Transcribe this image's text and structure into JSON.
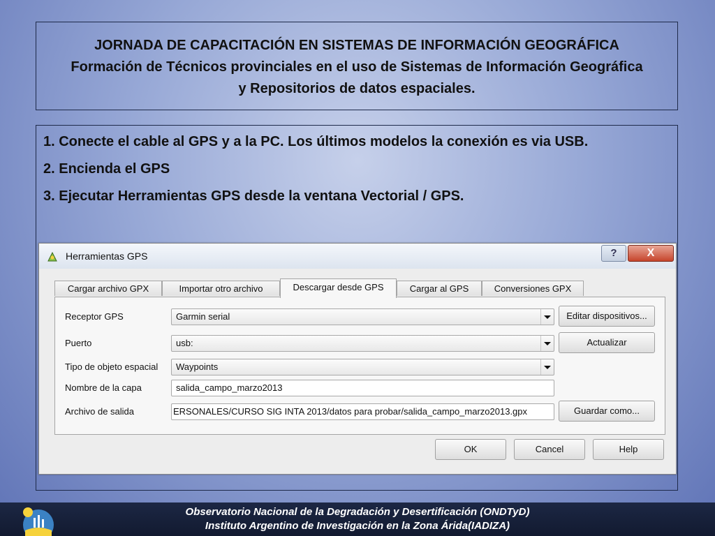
{
  "header": {
    "title_line1": "JORNADA DE CAPACITACIÓN EN SISTEMAS DE INFORMACIÓN GEOGRÁFICA",
    "title_line2": "Formación de Técnicos provinciales en el uso de Sistemas de Información Geográfica",
    "title_line3": "y  Repositorios de datos espaciales."
  },
  "steps": [
    "1. Conecte el cable al GPS y a la PC. Los últimos modelos la conexión es via USB.",
    "2. Encienda el GPS",
    "3. Ejecutar Herramientas GPS desde la ventana Vectorial / GPS."
  ],
  "dialog": {
    "title": "Herramientas GPS",
    "help_label": "?",
    "close_label": "X",
    "tabs": [
      {
        "label": "Cargar archivo GPX"
      },
      {
        "label": "Importar otro archivo"
      },
      {
        "label": "Descargar desde GPS",
        "active": true
      },
      {
        "label": "Cargar al GPS"
      },
      {
        "label": "Conversiones GPX"
      }
    ],
    "fields": {
      "receptor_label": "Receptor GPS",
      "receptor_value": "Garmin serial",
      "puerto_label": "Puerto",
      "puerto_value": "usb:",
      "tipo_label": "Tipo de objeto espacial",
      "tipo_value": "Waypoints",
      "nombre_label": "Nombre de la capa",
      "nombre_value": "salida_campo_marzo2013",
      "archivo_label": "Archivo de salida",
      "archivo_value": "ERSONALES/CURSO SIG INTA 2013/datos para probar/salida_campo_marzo2013.gpx"
    },
    "buttons": {
      "editar": "Editar dispositivos...",
      "actualizar": "Actualizar",
      "guardar": "Guardar como...",
      "ok": "OK",
      "cancel": "Cancel",
      "help": "Help"
    }
  },
  "footer": {
    "line1": "Observatorio Nacional de la Degradación y Desertificación (ONDTyD)",
    "line2": "Instituto Argentino de Investigación en la Zona Árida(IADIZA)"
  },
  "colors": {
    "background": "#97a8d6",
    "footer": "#1c2744",
    "close_button": "#c6452c"
  }
}
